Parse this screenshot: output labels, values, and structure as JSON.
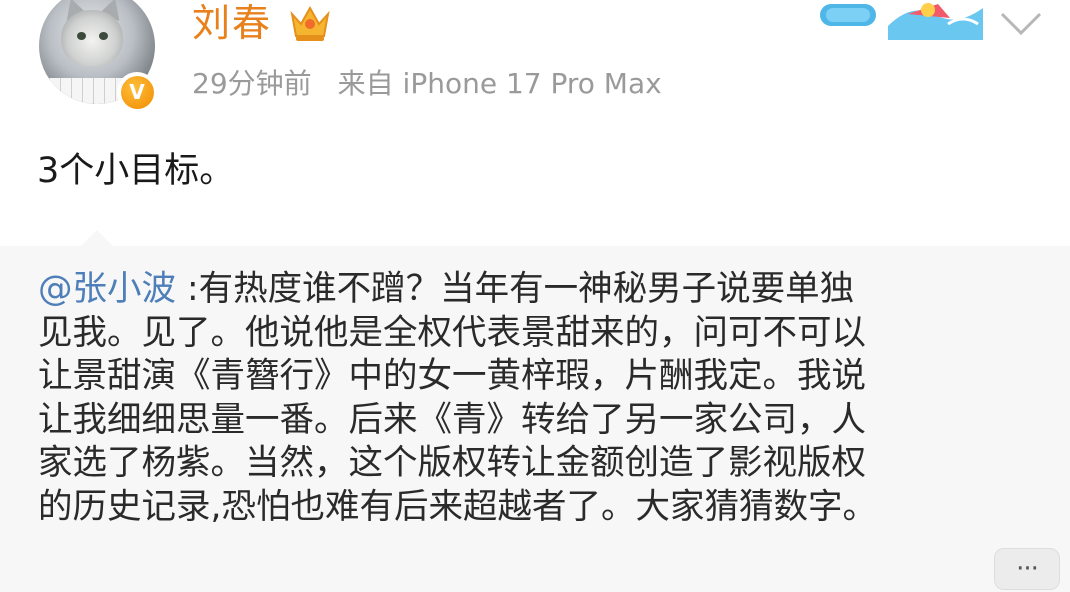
{
  "author": {
    "name": "刘春",
    "avatar_icon": "cat-avatar",
    "verified_icon": "verified-v-icon",
    "verified_letter": "V",
    "member_icon": "crown-icon",
    "badge_icon": "surf-badge-icon"
  },
  "meta": {
    "time": "29分钟前",
    "source": "来自 iPhone 17 Pro Max"
  },
  "post": {
    "text": "3个小目标。"
  },
  "repost": {
    "mention": "@张小波",
    "lines": [
      " :有热度谁不蹭？当年有一神秘男子说要单独",
      "见我。见了。他说他是全权代表景甜来的，问可不可以",
      "让景甜演《青簪行》中的女一黄梓瑕，片酬我定。我说",
      "让我细细思量一番。后来《青》转给了另一家公司，人",
      "家选了杨紫。当然，这个版权转让金额创造了影视版权",
      "的历史记录,恐怕也难有后来超越者了。大家猜猜数字。"
    ]
  },
  "more_button": {
    "label": "···",
    "icon": "more-icon"
  },
  "colors": {
    "username": "#e8811c",
    "meta": "#9a9a9a",
    "mention": "#4e7fb8",
    "repost_bg": "#f7f7f7"
  }
}
